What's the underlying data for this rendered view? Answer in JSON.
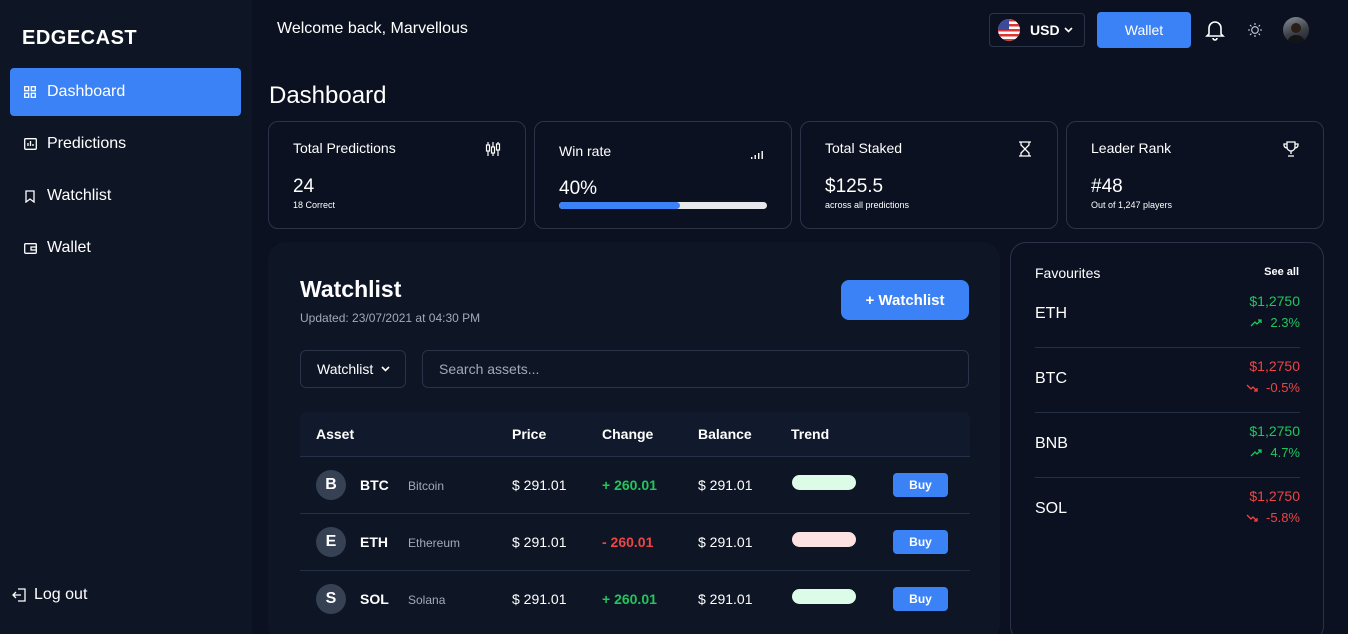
{
  "brand": "EDGECAST",
  "nav": [
    {
      "label": "Dashboard",
      "icon": "grid-icon",
      "active": true
    },
    {
      "label": "Predictions",
      "icon": "chart-icon",
      "active": false
    },
    {
      "label": "Watchlist",
      "icon": "bookmark-icon",
      "active": false
    },
    {
      "label": "Wallet",
      "icon": "wallet-icon",
      "active": false
    }
  ],
  "logout_label": "Log out",
  "header": {
    "welcome": "Welcome back, Marvellous",
    "currency": "USD",
    "wallet_label": "Wallet"
  },
  "page_title": "Dashboard",
  "stats": {
    "predictions": {
      "title": "Total Predictions",
      "value": "24",
      "sub": "18 Correct"
    },
    "winrate": {
      "title": "Win rate",
      "value": "40%",
      "progress": 0.58
    },
    "staked": {
      "title": "Total Staked",
      "value": "$125.5",
      "sub": "across all predictions"
    },
    "rank": {
      "title": "Leader Rank",
      "value": "#48",
      "sub": "Out of 1,247 players"
    }
  },
  "watchlist": {
    "title": "Watchlist",
    "updated": "Updated: 23/07/2021 at 04:30 PM",
    "add_label": "+ Watchlist",
    "select_value": "Watchlist",
    "search_placeholder": "Search assets...",
    "columns": {
      "asset": "Asset",
      "price": "Price",
      "change": "Change",
      "balance": "Balance",
      "trend": "Trend"
    },
    "buy_label": "Buy",
    "rows": [
      {
        "letter": "B",
        "symbol": "BTC",
        "name": "Bitcoin",
        "price": "$ 291.01",
        "change": "+ 260.01",
        "balance": "$ 291.01",
        "direction": "up"
      },
      {
        "letter": "E",
        "symbol": "ETH",
        "name": "Ethereum",
        "price": "$ 291.01",
        "change": "- 260.01",
        "balance": "$ 291.01",
        "direction": "down"
      },
      {
        "letter": "S",
        "symbol": "SOL",
        "name": "Solana",
        "price": "$ 291.01",
        "change": "+ 260.01",
        "balance": "$ 291.01",
        "direction": "up"
      }
    ]
  },
  "favourites": {
    "title": "Favourites",
    "see_all": "See all",
    "items": [
      {
        "symbol": "ETH",
        "price": "$1,2750",
        "change": "2.3%",
        "direction": "up"
      },
      {
        "symbol": "BTC",
        "price": "$1,2750",
        "change": "-0.5%",
        "direction": "down"
      },
      {
        "symbol": "BNB",
        "price": "$1,2750",
        "change": "4.7%",
        "direction": "up"
      },
      {
        "symbol": "SOL",
        "price": "$1,2750",
        "change": "-5.8%",
        "direction": "down"
      }
    ]
  },
  "colors": {
    "accent": "#3b82f6",
    "positive": "#22c55e",
    "negative": "#ef4444",
    "trend_up": "#dcfce7",
    "trend_down": "#fee2e2"
  }
}
